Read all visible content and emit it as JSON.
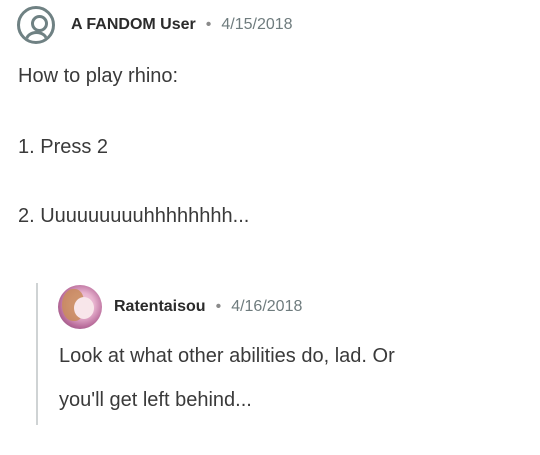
{
  "post": {
    "author": "A FANDOM User",
    "separator": "•",
    "date": "4/15/2018",
    "lines": [
      "How to play rhino:",
      "1. Press 2",
      "2. Uuuuuuuuuhhhhhhhh..."
    ]
  },
  "reply": {
    "author": "Ratentaisou",
    "separator": "•",
    "date": "4/16/2018",
    "lines": [
      "Look at what other abilities do, lad. Or",
      "you'll get left behind..."
    ]
  }
}
